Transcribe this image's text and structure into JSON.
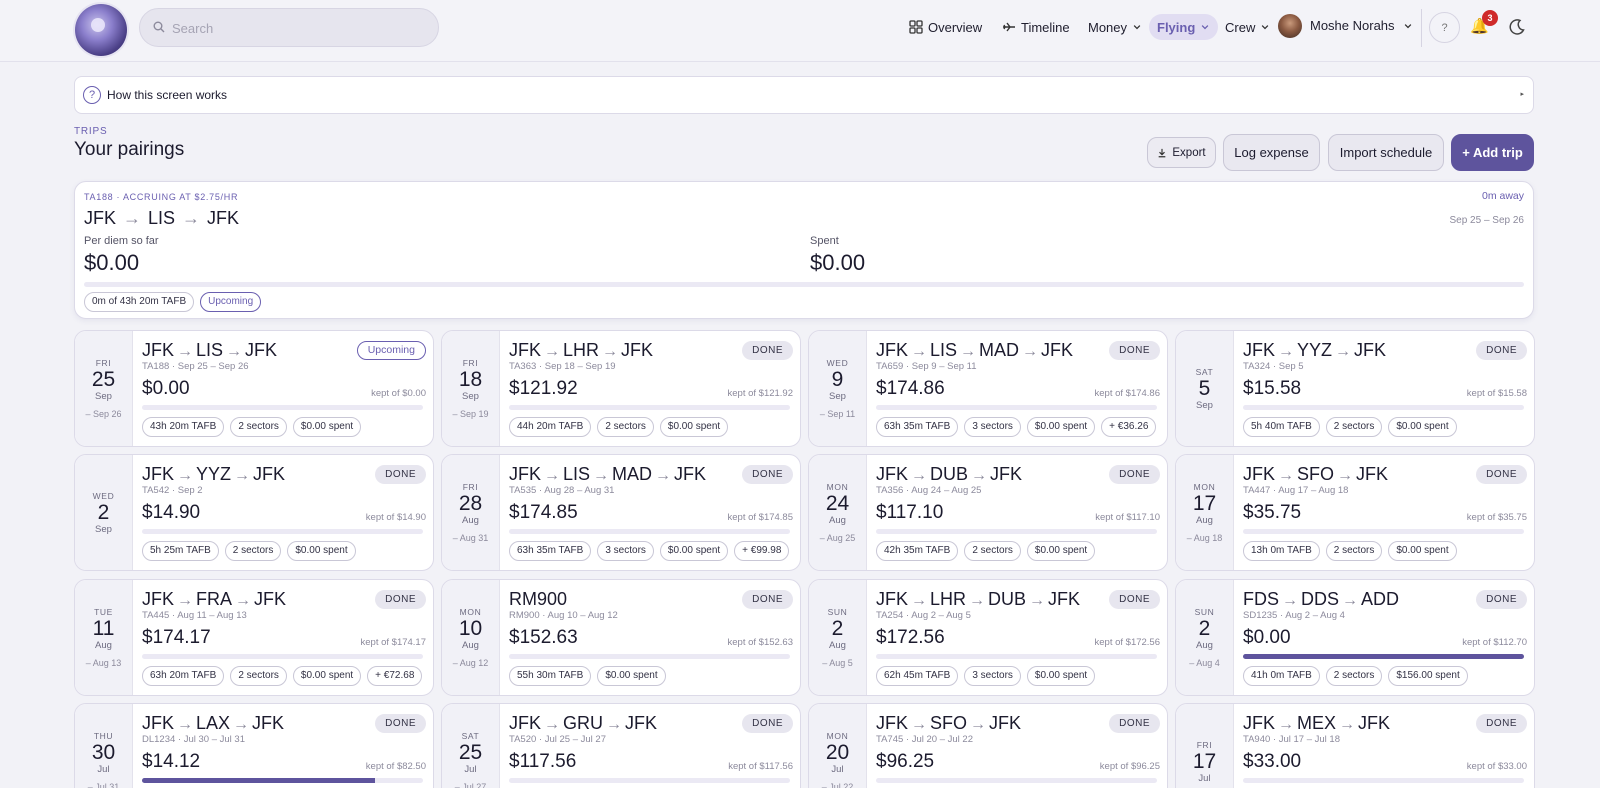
{
  "search": {
    "placeholder": "Search"
  },
  "nav": {
    "overview": "Overview",
    "timeline": "Timeline",
    "money": "Money",
    "flying": "Flying",
    "crew": "Crew",
    "user": "Moshe Norahs",
    "help": "?",
    "notifications": "3"
  },
  "how": {
    "label": "How this screen works",
    "arrow": "▸"
  },
  "header": {
    "eyebrow": "TRIPS",
    "title": "Your pairings"
  },
  "actions": {
    "export": "Export",
    "log_expense": "Log expense",
    "import_schedule": "Import schedule",
    "add_trip": "+ Add trip"
  },
  "hero": {
    "eyebrow": "TA188 · ACCRUING AT $2.75/HR",
    "away": "0m away",
    "route": [
      "JFK",
      "LIS",
      "JFK"
    ],
    "dates": "Sep 25 – Sep 26",
    "per_diem_label": "Per diem so far",
    "per_diem_value": "$0.00",
    "spent_label": "Spent",
    "spent_value": "$0.00",
    "progress": 0,
    "tafb": "0m of 43h 20m TAFB",
    "status": "Upcoming"
  },
  "cards": [
    {
      "wd": "FRI",
      "day": "25",
      "mon": "Sep",
      "end": "– Sep 26",
      "route": [
        "JFK",
        "LIS",
        "JFK"
      ],
      "sub": "TA188 · Sep 25 – Sep 26",
      "badge": "Upcoming",
      "upcoming": true,
      "amt": "$0.00",
      "kept": "kept of $0.00",
      "progress": 0,
      "pills": [
        "43h 20m TAFB",
        "2 sectors",
        "$0.00 spent"
      ]
    },
    {
      "wd": "FRI",
      "day": "18",
      "mon": "Sep",
      "end": "– Sep 19",
      "route": [
        "JFK",
        "LHR",
        "JFK"
      ],
      "sub": "TA363 · Sep 18 – Sep 19",
      "badge": "DONE",
      "amt": "$121.92",
      "kept": "kept of $121.92",
      "progress": 0,
      "pills": [
        "44h 20m TAFB",
        "2 sectors",
        "$0.00 spent"
      ]
    },
    {
      "wd": "WED",
      "day": "9",
      "mon": "Sep",
      "end": "– Sep 11",
      "route": [
        "JFK",
        "LIS",
        "MAD",
        "JFK"
      ],
      "sub": "TA659 · Sep 9 – Sep 11",
      "badge": "DONE",
      "amt": "$174.86",
      "kept": "kept of $174.86",
      "progress": 0,
      "pills": [
        "63h 35m TAFB",
        "3 sectors",
        "$0.00 spent",
        "+ €36.26"
      ]
    },
    {
      "wd": "SAT",
      "day": "5",
      "mon": "Sep",
      "end": "",
      "route": [
        "JFK",
        "YYZ",
        "JFK"
      ],
      "sub": "TA324 · Sep 5",
      "badge": "DONE",
      "amt": "$15.58",
      "kept": "kept of $15.58",
      "progress": 0,
      "pills": [
        "5h 40m TAFB",
        "2 sectors",
        "$0.00 spent"
      ]
    },
    {
      "wd": "WED",
      "day": "2",
      "mon": "Sep",
      "end": "",
      "route": [
        "JFK",
        "YYZ",
        "JFK"
      ],
      "sub": "TA542 · Sep 2",
      "badge": "DONE",
      "amt": "$14.90",
      "kept": "kept of $14.90",
      "progress": 0,
      "pills": [
        "5h 25m TAFB",
        "2 sectors",
        "$0.00 spent"
      ]
    },
    {
      "wd": "FRI",
      "day": "28",
      "mon": "Aug",
      "end": "– Aug 31",
      "route": [
        "JFK",
        "LIS",
        "MAD",
        "JFK"
      ],
      "sub": "TA535 · Aug 28 – Aug 31",
      "badge": "DONE",
      "amt": "$174.85",
      "kept": "kept of $174.85",
      "progress": 0,
      "pills": [
        "63h 35m TAFB",
        "3 sectors",
        "$0.00 spent",
        "+ €99.98"
      ]
    },
    {
      "wd": "MON",
      "day": "24",
      "mon": "Aug",
      "end": "– Aug 25",
      "route": [
        "JFK",
        "DUB",
        "JFK"
      ],
      "sub": "TA356 · Aug 24 – Aug 25",
      "badge": "DONE",
      "amt": "$117.10",
      "kept": "kept of $117.10",
      "progress": 0,
      "pills": [
        "42h 35m TAFB",
        "2 sectors",
        "$0.00 spent"
      ]
    },
    {
      "wd": "MON",
      "day": "17",
      "mon": "Aug",
      "end": "– Aug 18",
      "route": [
        "JFK",
        "SFO",
        "JFK"
      ],
      "sub": "TA447 · Aug 17 – Aug 18",
      "badge": "DONE",
      "amt": "$35.75",
      "kept": "kept of $35.75",
      "progress": 0,
      "pills": [
        "13h 0m TAFB",
        "2 sectors",
        "$0.00 spent"
      ]
    },
    {
      "wd": "TUE",
      "day": "11",
      "mon": "Aug",
      "end": "– Aug 13",
      "route": [
        "JFK",
        "FRA",
        "JFK"
      ],
      "sub": "TA445 · Aug 11 – Aug 13",
      "badge": "DONE",
      "amt": "$174.17",
      "kept": "kept of $174.17",
      "progress": 0,
      "pills": [
        "63h 20m TAFB",
        "2 sectors",
        "$0.00 spent",
        "+ €72.68"
      ]
    },
    {
      "wd": "MON",
      "day": "10",
      "mon": "Aug",
      "end": "– Aug 12",
      "route": [
        "RM900"
      ],
      "sub": "RM900 · Aug 10 – Aug 12",
      "badge": "DONE",
      "amt": "$152.63",
      "kept": "kept of $152.63",
      "progress": 0,
      "pills": [
        "55h 30m TAFB",
        "$0.00 spent"
      ]
    },
    {
      "wd": "SUN",
      "day": "2",
      "mon": "Aug",
      "end": "– Aug 5",
      "route": [
        "JFK",
        "LHR",
        "DUB",
        "JFK"
      ],
      "sub": "TA254 · Aug 2 – Aug 5",
      "badge": "DONE",
      "amt": "$172.56",
      "kept": "kept of $172.56",
      "progress": 0,
      "pills": [
        "62h 45m TAFB",
        "3 sectors",
        "$0.00 spent"
      ]
    },
    {
      "wd": "SUN",
      "day": "2",
      "mon": "Aug",
      "end": "– Aug 4",
      "route": [
        "FDS",
        "DDS",
        "ADD"
      ],
      "sub": "SD1235 · Aug 2 – Aug 4",
      "badge": "DONE",
      "amt": "$0.00",
      "kept": "kept of $112.70",
      "progress": 1,
      "pills": [
        "41h 0m TAFB",
        "2 sectors",
        "$156.00 spent"
      ]
    },
    {
      "wd": "THU",
      "day": "30",
      "mon": "Jul",
      "end": "– Jul 31",
      "route": [
        "JFK",
        "LAX",
        "JFK"
      ],
      "sub": "DL1234 · Jul 30 – Jul 31",
      "badge": "DONE",
      "amt": "$14.12",
      "kept": "kept of $82.50",
      "progress": 0.83,
      "pills": []
    },
    {
      "wd": "SAT",
      "day": "25",
      "mon": "Jul",
      "end": "– Jul 27",
      "route": [
        "JFK",
        "GRU",
        "JFK"
      ],
      "sub": "TA520 · Jul 25 – Jul 27",
      "badge": "DONE",
      "amt": "$117.56",
      "kept": "kept of $117.56",
      "progress": 0,
      "pills": []
    },
    {
      "wd": "MON",
      "day": "20",
      "mon": "Jul",
      "end": "– Jul 22",
      "route": [
        "JFK",
        "SFO",
        "JFK"
      ],
      "sub": "TA745 · Jul 20 – Jul 22",
      "badge": "DONE",
      "amt": "$96.25",
      "kept": "kept of $96.25",
      "progress": 0,
      "pills": []
    },
    {
      "wd": "FRI",
      "day": "17",
      "mon": "Jul",
      "end": "",
      "route": [
        "JFK",
        "MEX",
        "JFK"
      ],
      "sub": "TA940 · Jul 17 – Jul 18",
      "badge": "DONE",
      "amt": "$33.00",
      "kept": "kept of $33.00",
      "progress": 0,
      "pills": []
    }
  ]
}
